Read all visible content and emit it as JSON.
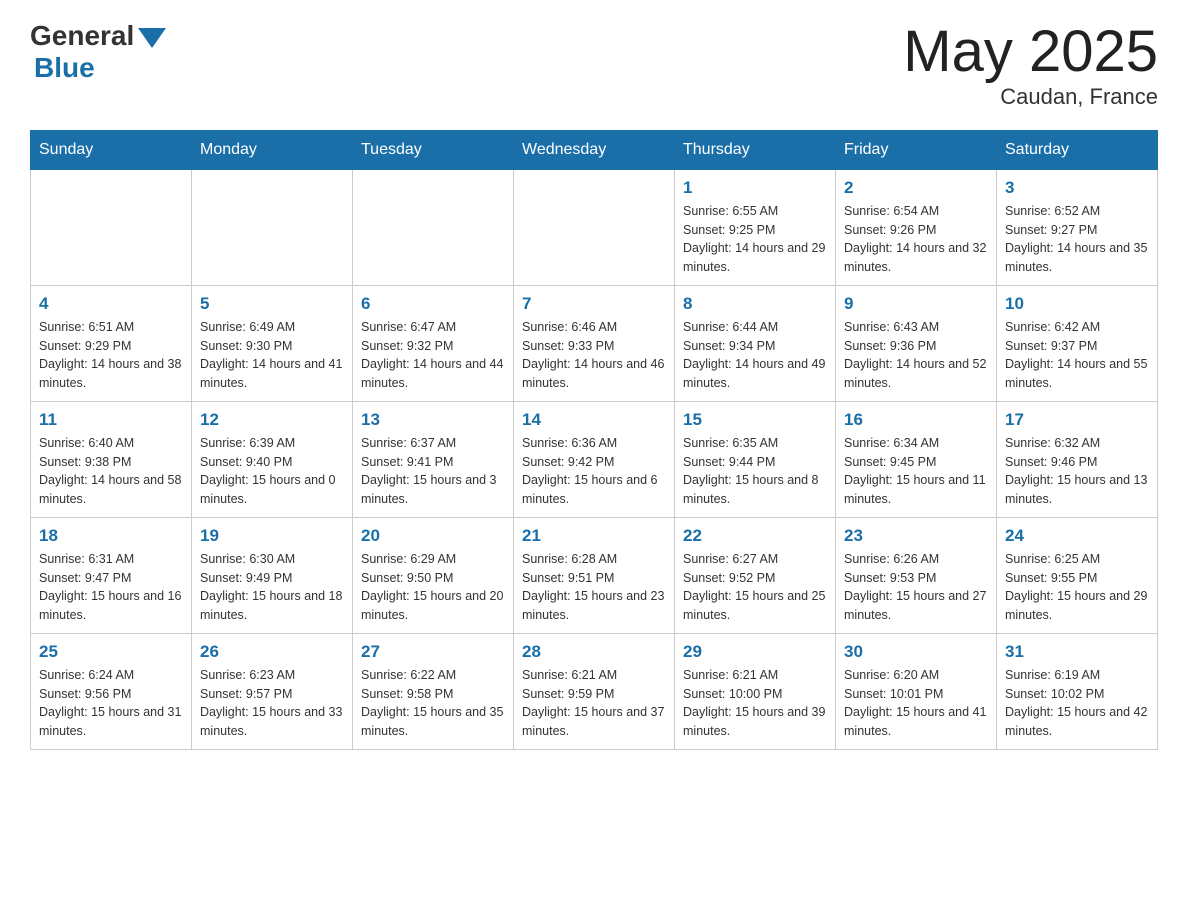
{
  "header": {
    "logo_general": "General",
    "logo_blue": "Blue",
    "month_title": "May 2025",
    "location": "Caudan, France"
  },
  "days_of_week": [
    "Sunday",
    "Monday",
    "Tuesday",
    "Wednesday",
    "Thursday",
    "Friday",
    "Saturday"
  ],
  "weeks": [
    [
      {
        "day": "",
        "info": ""
      },
      {
        "day": "",
        "info": ""
      },
      {
        "day": "",
        "info": ""
      },
      {
        "day": "",
        "info": ""
      },
      {
        "day": "1",
        "info": "Sunrise: 6:55 AM\nSunset: 9:25 PM\nDaylight: 14 hours and 29 minutes."
      },
      {
        "day": "2",
        "info": "Sunrise: 6:54 AM\nSunset: 9:26 PM\nDaylight: 14 hours and 32 minutes."
      },
      {
        "day": "3",
        "info": "Sunrise: 6:52 AM\nSunset: 9:27 PM\nDaylight: 14 hours and 35 minutes."
      }
    ],
    [
      {
        "day": "4",
        "info": "Sunrise: 6:51 AM\nSunset: 9:29 PM\nDaylight: 14 hours and 38 minutes."
      },
      {
        "day": "5",
        "info": "Sunrise: 6:49 AM\nSunset: 9:30 PM\nDaylight: 14 hours and 41 minutes."
      },
      {
        "day": "6",
        "info": "Sunrise: 6:47 AM\nSunset: 9:32 PM\nDaylight: 14 hours and 44 minutes."
      },
      {
        "day": "7",
        "info": "Sunrise: 6:46 AM\nSunset: 9:33 PM\nDaylight: 14 hours and 46 minutes."
      },
      {
        "day": "8",
        "info": "Sunrise: 6:44 AM\nSunset: 9:34 PM\nDaylight: 14 hours and 49 minutes."
      },
      {
        "day": "9",
        "info": "Sunrise: 6:43 AM\nSunset: 9:36 PM\nDaylight: 14 hours and 52 minutes."
      },
      {
        "day": "10",
        "info": "Sunrise: 6:42 AM\nSunset: 9:37 PM\nDaylight: 14 hours and 55 minutes."
      }
    ],
    [
      {
        "day": "11",
        "info": "Sunrise: 6:40 AM\nSunset: 9:38 PM\nDaylight: 14 hours and 58 minutes."
      },
      {
        "day": "12",
        "info": "Sunrise: 6:39 AM\nSunset: 9:40 PM\nDaylight: 15 hours and 0 minutes."
      },
      {
        "day": "13",
        "info": "Sunrise: 6:37 AM\nSunset: 9:41 PM\nDaylight: 15 hours and 3 minutes."
      },
      {
        "day": "14",
        "info": "Sunrise: 6:36 AM\nSunset: 9:42 PM\nDaylight: 15 hours and 6 minutes."
      },
      {
        "day": "15",
        "info": "Sunrise: 6:35 AM\nSunset: 9:44 PM\nDaylight: 15 hours and 8 minutes."
      },
      {
        "day": "16",
        "info": "Sunrise: 6:34 AM\nSunset: 9:45 PM\nDaylight: 15 hours and 11 minutes."
      },
      {
        "day": "17",
        "info": "Sunrise: 6:32 AM\nSunset: 9:46 PM\nDaylight: 15 hours and 13 minutes."
      }
    ],
    [
      {
        "day": "18",
        "info": "Sunrise: 6:31 AM\nSunset: 9:47 PM\nDaylight: 15 hours and 16 minutes."
      },
      {
        "day": "19",
        "info": "Sunrise: 6:30 AM\nSunset: 9:49 PM\nDaylight: 15 hours and 18 minutes."
      },
      {
        "day": "20",
        "info": "Sunrise: 6:29 AM\nSunset: 9:50 PM\nDaylight: 15 hours and 20 minutes."
      },
      {
        "day": "21",
        "info": "Sunrise: 6:28 AM\nSunset: 9:51 PM\nDaylight: 15 hours and 23 minutes."
      },
      {
        "day": "22",
        "info": "Sunrise: 6:27 AM\nSunset: 9:52 PM\nDaylight: 15 hours and 25 minutes."
      },
      {
        "day": "23",
        "info": "Sunrise: 6:26 AM\nSunset: 9:53 PM\nDaylight: 15 hours and 27 minutes."
      },
      {
        "day": "24",
        "info": "Sunrise: 6:25 AM\nSunset: 9:55 PM\nDaylight: 15 hours and 29 minutes."
      }
    ],
    [
      {
        "day": "25",
        "info": "Sunrise: 6:24 AM\nSunset: 9:56 PM\nDaylight: 15 hours and 31 minutes."
      },
      {
        "day": "26",
        "info": "Sunrise: 6:23 AM\nSunset: 9:57 PM\nDaylight: 15 hours and 33 minutes."
      },
      {
        "day": "27",
        "info": "Sunrise: 6:22 AM\nSunset: 9:58 PM\nDaylight: 15 hours and 35 minutes."
      },
      {
        "day": "28",
        "info": "Sunrise: 6:21 AM\nSunset: 9:59 PM\nDaylight: 15 hours and 37 minutes."
      },
      {
        "day": "29",
        "info": "Sunrise: 6:21 AM\nSunset: 10:00 PM\nDaylight: 15 hours and 39 minutes."
      },
      {
        "day": "30",
        "info": "Sunrise: 6:20 AM\nSunset: 10:01 PM\nDaylight: 15 hours and 41 minutes."
      },
      {
        "day": "31",
        "info": "Sunrise: 6:19 AM\nSunset: 10:02 PM\nDaylight: 15 hours and 42 minutes."
      }
    ]
  ]
}
